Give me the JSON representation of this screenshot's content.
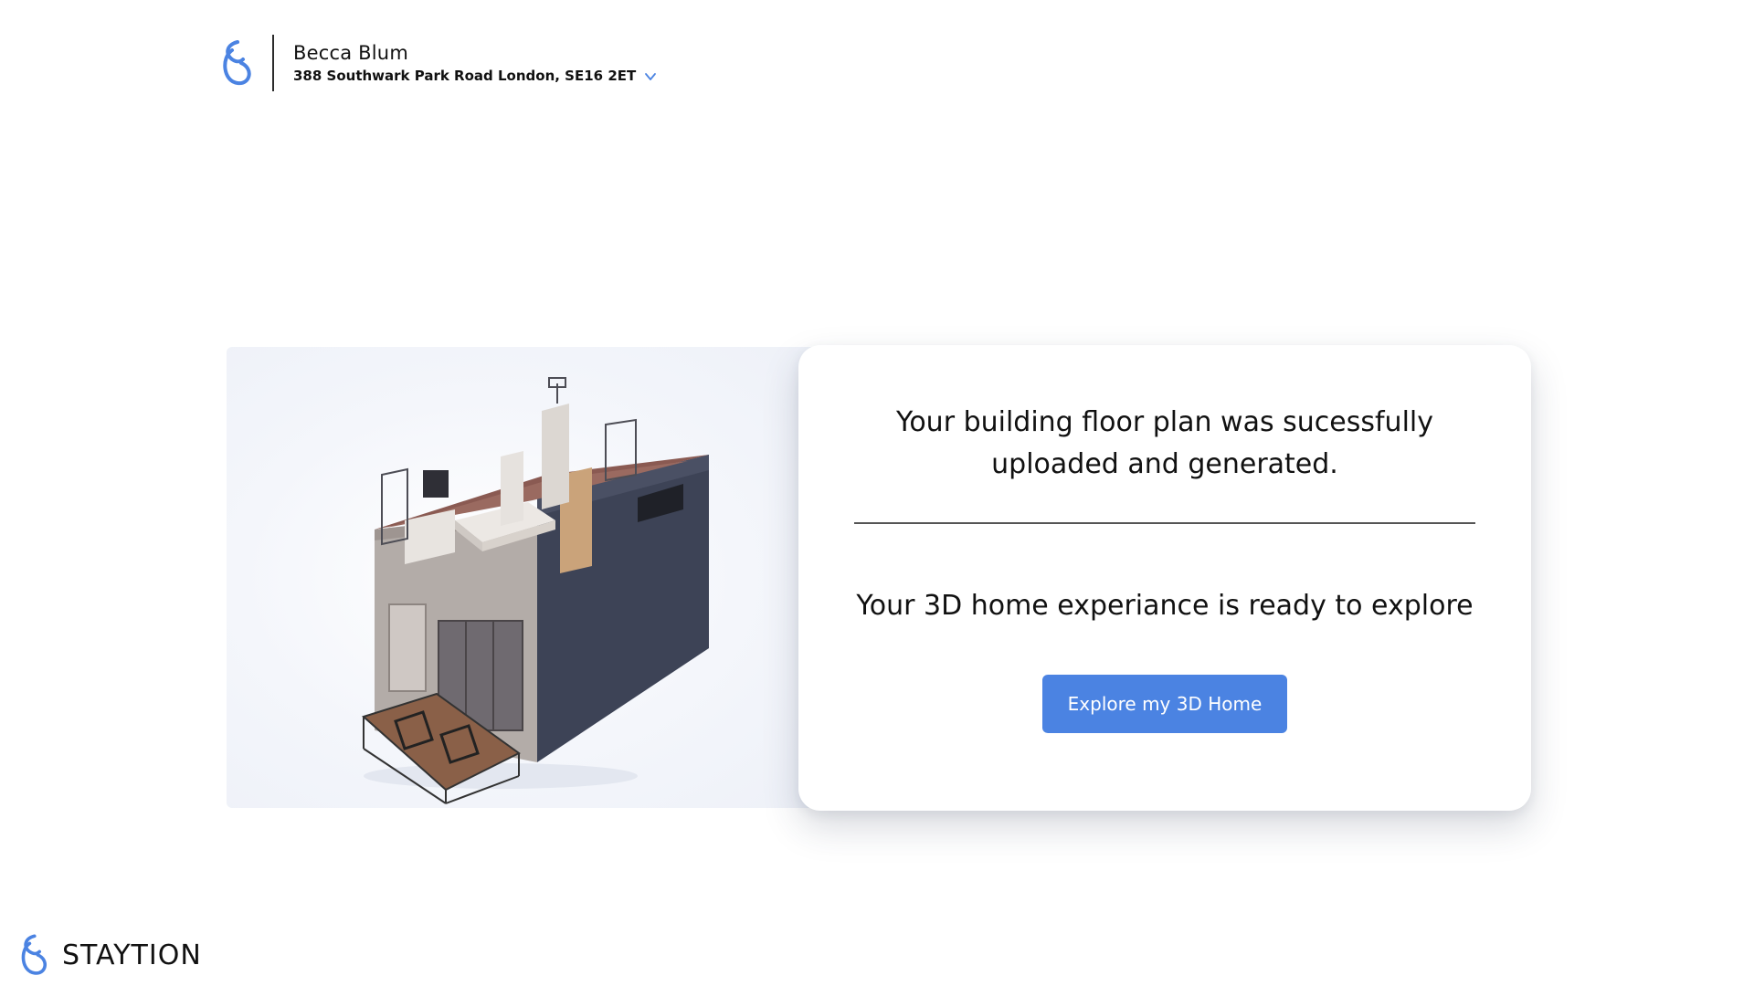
{
  "header": {
    "user_name": "Becca Blum",
    "address": "388 Southwark Park Road London, SE16 2ET",
    "logo_icon": "staytion-logo-icon",
    "dropdown_icon": "chevron-down-icon"
  },
  "main": {
    "title": "Your building floor plan was sucessfully uploaded and generated.",
    "subtitle": "Your 3D home experiance is ready to explore",
    "explore_button_label": "Explore my 3D Home"
  },
  "footer": {
    "brand_name": "STAYTION"
  },
  "colors": {
    "accent": "#4b83e2",
    "logo": "#4b83e2",
    "text": "#111111"
  }
}
